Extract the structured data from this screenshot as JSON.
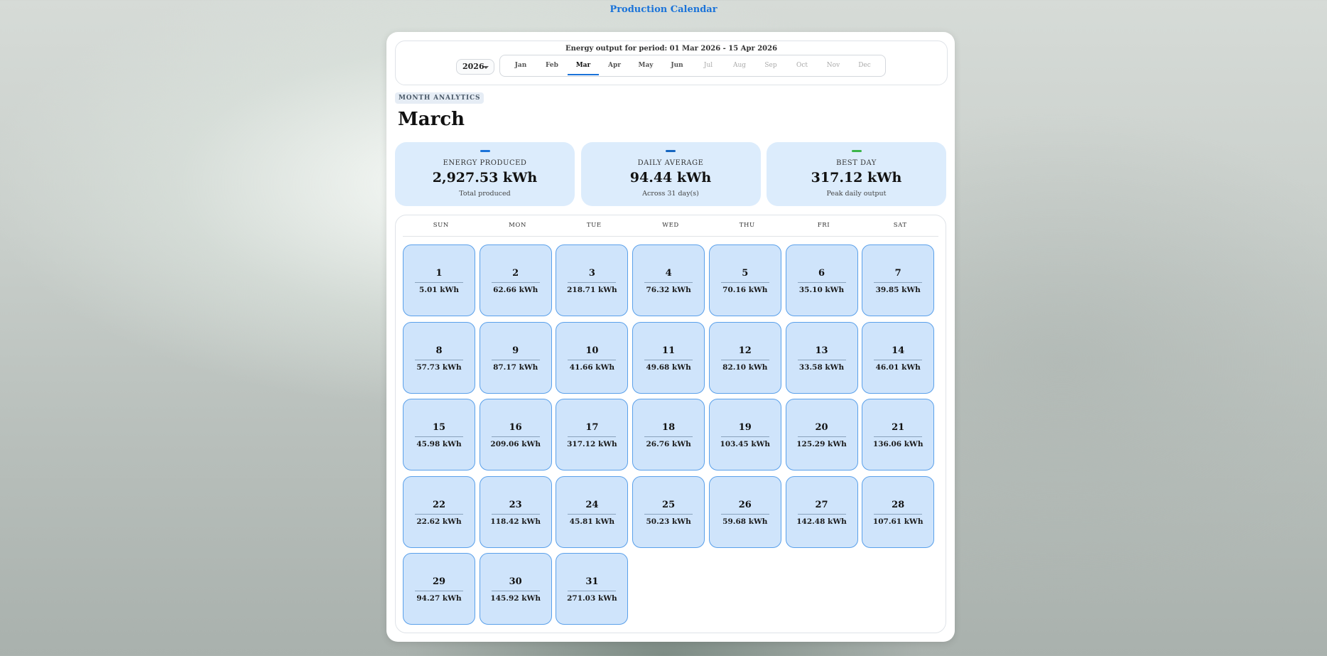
{
  "app": {
    "title": "Production Calendar"
  },
  "period": {
    "text": "Energy output for period: 01 Mar 2026 - 15 Apr 2026"
  },
  "year_select": {
    "value": "2026"
  },
  "months": [
    {
      "label": "Jan",
      "state": "enabled"
    },
    {
      "label": "Feb",
      "state": "enabled"
    },
    {
      "label": "Mar",
      "state": "active"
    },
    {
      "label": "Apr",
      "state": "enabled"
    },
    {
      "label": "May",
      "state": "enabled"
    },
    {
      "label": "Jun",
      "state": "enabled"
    },
    {
      "label": "Jul",
      "state": "disabled"
    },
    {
      "label": "Aug",
      "state": "disabled"
    },
    {
      "label": "Sep",
      "state": "disabled"
    },
    {
      "label": "Oct",
      "state": "disabled"
    },
    {
      "label": "Nov",
      "state": "disabled"
    },
    {
      "label": "Dec",
      "state": "disabled"
    }
  ],
  "section": {
    "badge": "MONTH ANALYTICS",
    "title": "March"
  },
  "stats": [
    {
      "label": "ENERGY PRODUCED",
      "value": "2,927.53 kWh",
      "sub": "Total produced",
      "accent": "#1a73d9"
    },
    {
      "label": "DAILY AVERAGE",
      "value": "94.44 kWh",
      "sub": "Across 31 day(s)",
      "accent": "#1565c0"
    },
    {
      "label": "BEST DAY",
      "value": "317.12 kWh",
      "sub": "Peak daily output",
      "accent": "#3bb54a"
    }
  ],
  "weekdays": [
    "SUN",
    "MON",
    "TUE",
    "WED",
    "THU",
    "FRI",
    "SAT"
  ],
  "start_weekday": 0,
  "days": [
    {
      "day": "1",
      "value": "5.01 kWh"
    },
    {
      "day": "2",
      "value": "62.66 kWh"
    },
    {
      "day": "3",
      "value": "218.71 kWh"
    },
    {
      "day": "4",
      "value": "76.32 kWh"
    },
    {
      "day": "5",
      "value": "70.16 kWh"
    },
    {
      "day": "6",
      "value": "35.10 kWh"
    },
    {
      "day": "7",
      "value": "39.85 kWh"
    },
    {
      "day": "8",
      "value": "57.73 kWh"
    },
    {
      "day": "9",
      "value": "87.17 kWh"
    },
    {
      "day": "10",
      "value": "41.66 kWh"
    },
    {
      "day": "11",
      "value": "49.68 kWh"
    },
    {
      "day": "12",
      "value": "82.10 kWh"
    },
    {
      "day": "13",
      "value": "33.58 kWh"
    },
    {
      "day": "14",
      "value": "46.01 kWh"
    },
    {
      "day": "15",
      "value": "45.98 kWh"
    },
    {
      "day": "16",
      "value": "209.06 kWh"
    },
    {
      "day": "17",
      "value": "317.12 kWh"
    },
    {
      "day": "18",
      "value": "26.76 kWh"
    },
    {
      "day": "19",
      "value": "103.45 kWh"
    },
    {
      "day": "20",
      "value": "125.29 kWh"
    },
    {
      "day": "21",
      "value": "136.06 kWh"
    },
    {
      "day": "22",
      "value": "22.62 kWh"
    },
    {
      "day": "23",
      "value": "118.42 kWh"
    },
    {
      "day": "24",
      "value": "45.81 kWh"
    },
    {
      "day": "25",
      "value": "50.23 kWh"
    },
    {
      "day": "26",
      "value": "59.68 kWh"
    },
    {
      "day": "27",
      "value": "142.48 kWh"
    },
    {
      "day": "28",
      "value": "107.61 kWh"
    },
    {
      "day": "29",
      "value": "94.27 kWh"
    },
    {
      "day": "30",
      "value": "145.92 kWh"
    },
    {
      "day": "31",
      "value": "271.03 kWh"
    }
  ]
}
